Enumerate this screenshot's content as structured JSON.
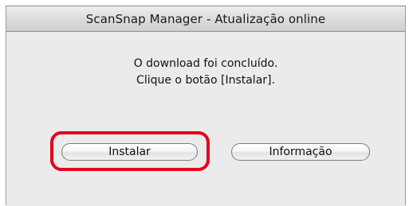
{
  "window": {
    "title": "ScanSnap Manager - Atualização online"
  },
  "message": {
    "line1": "O download foi concluído.",
    "line2": "Clique o botão [Instalar]."
  },
  "buttons": {
    "install_label": "Instalar",
    "info_label": "Informação"
  },
  "colors": {
    "highlight": "#e3001b"
  }
}
